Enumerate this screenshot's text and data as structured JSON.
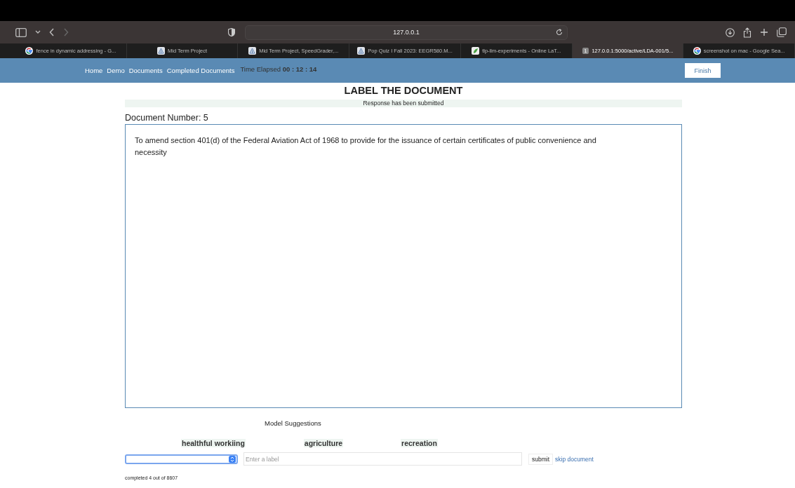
{
  "browser": {
    "address": "127.0.0.1",
    "tabs": [
      {
        "title": "fence in dynamic addressing - G...",
        "kind": "google",
        "selected": false
      },
      {
        "title": "Mid Term Project",
        "kind": "canvas",
        "selected": false
      },
      {
        "title": "Mid Term Project, SpeedGrader,...",
        "kind": "canvas",
        "selected": false
      },
      {
        "title": "Pop Quiz I Fall 2023: EEGR580.M...",
        "kind": "canvas",
        "selected": false
      },
      {
        "title": "tlp-llm-experiments - Online LaT...",
        "kind": "overleaf",
        "selected": false
      },
      {
        "title": "127.0.0.1:5000/active/LDA-001/5...",
        "kind": "number",
        "badge": "1",
        "selected": true
      },
      {
        "title": "screenshot on mac - Google Sea...",
        "kind": "google",
        "selected": false
      }
    ]
  },
  "nav": {
    "links": [
      "Home",
      "Demo",
      "Documents",
      "Completed Documents"
    ],
    "timer_label": "Time Elapsed",
    "timer": "00 : 12 : 14",
    "finish": "Finish"
  },
  "heading": "LABEL THE DOCUMENT",
  "status": "Response has been submitted",
  "document_number": "Document Number: 5",
  "document_text": "To amend section 401(d) of the Federal Aviation Act of 1968 to provide for the issuance of certain certificates of public convenience and necessity",
  "suggestions_title": "Model Suggestions",
  "suggestions": [
    "healthful workiing",
    "agriculture",
    "recreation"
  ],
  "label_input": {
    "placeholder": "Enter a label"
  },
  "submit": "submit",
  "skip": "skip document",
  "progress": "completed 4 out of 8607"
}
